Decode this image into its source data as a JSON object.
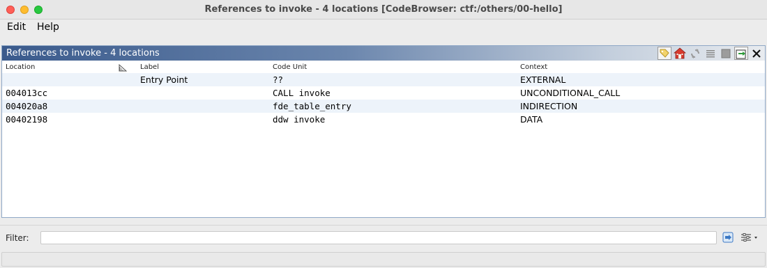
{
  "window": {
    "title": "References to invoke - 4 locations [CodeBrowser: ctf:/others/00-hello]"
  },
  "menubar": {
    "items": [
      "Edit",
      "Help"
    ]
  },
  "panel": {
    "title": "References to invoke - 4 locations",
    "toolbar_icons": [
      "tag-icon",
      "home-icon",
      "refresh-icon",
      "list-icon",
      "stop-icon",
      "export-icon",
      "close-icon"
    ]
  },
  "table": {
    "columns": [
      "Location",
      "Label",
      "Code Unit",
      "Context"
    ],
    "rows": [
      {
        "location": "",
        "label": "Entry Point",
        "code_unit": "??",
        "context": "EXTERNAL"
      },
      {
        "location": "004013cc",
        "label": "",
        "code_unit": "CALL invoke",
        "context": "UNCONDITIONAL_CALL"
      },
      {
        "location": "004020a8",
        "label": "",
        "code_unit": "fde_table_entry",
        "context": "INDIRECTION"
      },
      {
        "location": "00402198",
        "label": "",
        "code_unit": "ddw invoke",
        "context": "DATA"
      }
    ]
  },
  "filter": {
    "label": "Filter:",
    "value": ""
  }
}
